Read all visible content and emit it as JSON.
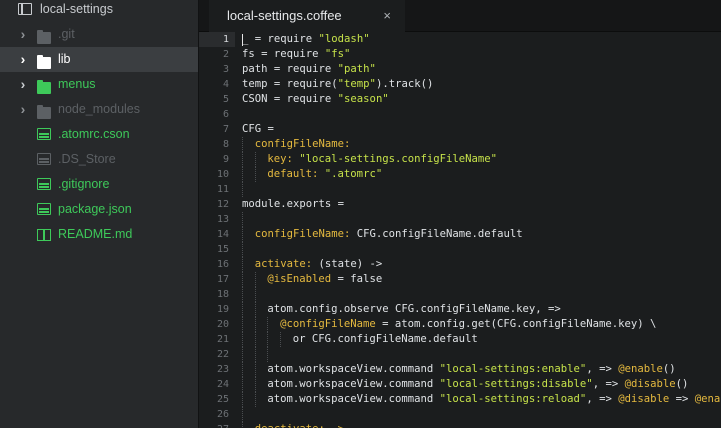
{
  "sidebar": {
    "items": [
      {
        "label": "local-settings",
        "kind": "repo",
        "color": "root",
        "expanded": null
      },
      {
        "label": ".git",
        "kind": "folder",
        "color": "dim",
        "expanded": false
      },
      {
        "label": "lib",
        "kind": "folder",
        "color": "lib",
        "expanded": false,
        "selected": true
      },
      {
        "label": "menus",
        "kind": "folder",
        "color": "green",
        "expanded": false
      },
      {
        "label": "node_modules",
        "kind": "folder",
        "color": "dim",
        "expanded": false
      },
      {
        "label": ".atomrc.cson",
        "kind": "file",
        "color": "green"
      },
      {
        "label": ".DS_Store",
        "kind": "file",
        "color": "dim"
      },
      {
        "label": ".gitignore",
        "kind": "file",
        "color": "green"
      },
      {
        "label": "package.json",
        "kind": "file",
        "color": "green"
      },
      {
        "label": "README.md",
        "kind": "book",
        "color": "green"
      }
    ],
    "colors": {
      "root": "#c8cbcf",
      "dim": "#5c6064",
      "lib": "#ffffff",
      "green": "#3ec95a"
    }
  },
  "tab": {
    "title": "local-settings.coffee",
    "close_glyph": "×"
  },
  "editor": {
    "current_line": 1,
    "lines": [
      {
        "n": "1",
        "indent": 0,
        "tokens": [
          [
            "_ = require ",
            ""
          ],
          [
            "\"lodash\"",
            "str"
          ]
        ]
      },
      {
        "n": "2",
        "indent": 0,
        "tokens": [
          [
            "fs = require ",
            ""
          ],
          [
            "\"fs\"",
            "str"
          ]
        ]
      },
      {
        "n": "3",
        "indent": 0,
        "tokens": [
          [
            "path = require ",
            ""
          ],
          [
            "\"path\"",
            "str"
          ]
        ]
      },
      {
        "n": "4",
        "indent": 0,
        "tokens": [
          [
            "temp = require(",
            ""
          ],
          [
            "\"temp\"",
            "str"
          ],
          [
            ").track()",
            ""
          ]
        ]
      },
      {
        "n": "5",
        "indent": 0,
        "tokens": [
          [
            "CSON = require ",
            ""
          ],
          [
            "\"season\"",
            "str"
          ]
        ]
      },
      {
        "n": "6",
        "indent": 0,
        "tokens": []
      },
      {
        "n": "7",
        "indent": 0,
        "tokens": [
          [
            "CFG =",
            ""
          ]
        ]
      },
      {
        "n": "8",
        "indent": 1,
        "tokens": [
          [
            "configFileName:",
            "key"
          ]
        ]
      },
      {
        "n": "9",
        "indent": 2,
        "tokens": [
          [
            "key: ",
            "key"
          ],
          [
            "\"local-settings.configFileName\"",
            "str"
          ]
        ]
      },
      {
        "n": "10",
        "indent": 2,
        "tokens": [
          [
            "default: ",
            "key"
          ],
          [
            "\".atomrc\"",
            "str"
          ]
        ]
      },
      {
        "n": "11",
        "indent": 1,
        "tokens": []
      },
      {
        "n": "12",
        "indent": 0,
        "tokens": [
          [
            "module.exports =",
            ""
          ]
        ]
      },
      {
        "n": "13",
        "indent": 1,
        "tokens": []
      },
      {
        "n": "14",
        "indent": 1,
        "tokens": [
          [
            "configFileName: ",
            "key"
          ],
          [
            "CFG.configFileName.default",
            ""
          ]
        ]
      },
      {
        "n": "15",
        "indent": 1,
        "tokens": []
      },
      {
        "n": "16",
        "indent": 1,
        "tokens": [
          [
            "activate: ",
            "key"
          ],
          [
            "(state) ->",
            ""
          ]
        ]
      },
      {
        "n": "17",
        "indent": 2,
        "tokens": [
          [
            "@isEnabled",
            "key"
          ],
          [
            " = false",
            ""
          ]
        ]
      },
      {
        "n": "18",
        "indent": 2,
        "tokens": []
      },
      {
        "n": "19",
        "indent": 2,
        "tokens": [
          [
            "atom.config.observe CFG.configFileName.key, =>",
            ""
          ]
        ]
      },
      {
        "n": "20",
        "indent": 3,
        "tokens": [
          [
            "@configFileName",
            "key"
          ],
          [
            " = atom.config.get(CFG.configFileName.key) \\",
            ""
          ]
        ]
      },
      {
        "n": "21",
        "indent": 4,
        "tokens": [
          [
            "or CFG.configFileName.default",
            ""
          ]
        ]
      },
      {
        "n": "22",
        "indent": 3,
        "tokens": []
      },
      {
        "n": "23",
        "indent": 2,
        "tokens": [
          [
            "atom.workspaceView.command ",
            ""
          ],
          [
            "\"local-settings:enable\"",
            "str"
          ],
          [
            ", => ",
            ""
          ],
          [
            "@enable",
            "key"
          ],
          [
            "()",
            ""
          ]
        ]
      },
      {
        "n": "24",
        "indent": 2,
        "tokens": [
          [
            "atom.workspaceView.command ",
            ""
          ],
          [
            "\"local-settings:disable\"",
            "str"
          ],
          [
            ", => ",
            ""
          ],
          [
            "@disable",
            "key"
          ],
          [
            "()",
            ""
          ]
        ]
      },
      {
        "n": "25",
        "indent": 2,
        "tokens": [
          [
            "atom.workspaceView.command ",
            ""
          ],
          [
            "\"local-settings:reload\"",
            "str"
          ],
          [
            ", => ",
            ""
          ],
          [
            "@disable",
            "key"
          ],
          [
            " => ",
            ""
          ],
          [
            "@enable",
            "key"
          ],
          [
            "()",
            ""
          ]
        ]
      },
      {
        "n": "26",
        "indent": 1,
        "tokens": []
      },
      {
        "n": "27",
        "indent": 1,
        "tokens": [
          [
            "deactivate: ->",
            "key"
          ]
        ]
      }
    ]
  }
}
